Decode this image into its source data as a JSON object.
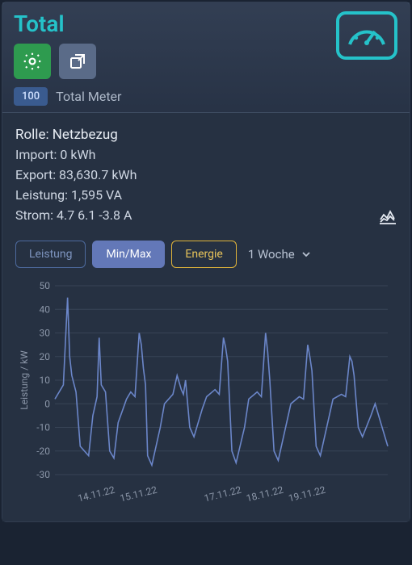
{
  "header": {
    "title": "Total",
    "badge_value": "100",
    "badge_label": "Total Meter"
  },
  "icons": {
    "gear": "gear-icon",
    "popout": "popout-icon",
    "meter": "meter-icon",
    "lines": "line-chart-icon",
    "chevron": "chevron-down-icon"
  },
  "info": {
    "role": "Rolle: Netzbezug",
    "import": "Import: 0 kWh",
    "export": "Export: 83,630.7 kWh",
    "power": "Leistung: 1,595 VA",
    "current": "Strom: 4.7 6.1 -3.8 A"
  },
  "buttons": {
    "leistung": "Leistung",
    "minmax": "Min/Max",
    "energie": "Energie"
  },
  "range": {
    "label": "1 Woche"
  },
  "chart_data": {
    "type": "line",
    "title": "",
    "xlabel": "",
    "ylabel": "Leistung / kW",
    "ylim": [
      -30,
      50
    ],
    "yticks": [
      -30,
      -20,
      -10,
      0,
      10,
      20,
      30,
      40,
      50
    ],
    "xticks": [
      "14.11.22",
      "15.11.22",
      "17.11.22",
      "18.11.22",
      "19.11.22"
    ],
    "series": [
      {
        "name": "Leistung",
        "color": "#6b86c9",
        "x": [
          13.0,
          13.2,
          13.3,
          13.35,
          13.4,
          13.5,
          13.6,
          13.8,
          13.9,
          14.0,
          14.05,
          14.1,
          14.2,
          14.3,
          14.4,
          14.5,
          14.7,
          14.8,
          14.9,
          15.0,
          15.05,
          15.1,
          15.15,
          15.2,
          15.3,
          15.5,
          15.6,
          15.8,
          15.9,
          16.0,
          16.05,
          16.1,
          16.2,
          16.3,
          16.5,
          16.6,
          16.8,
          16.9,
          17.0,
          17.05,
          17.1,
          17.2,
          17.3,
          17.5,
          17.6,
          17.8,
          17.9,
          18.0,
          18.05,
          18.1,
          18.2,
          18.3,
          18.5,
          18.6,
          18.8,
          18.9,
          19.0,
          19.05,
          19.1,
          19.2,
          19.3,
          19.5,
          19.6,
          19.8,
          19.9,
          20.0,
          20.05,
          20.1,
          20.2,
          20.3,
          20.5,
          20.6,
          20.8,
          20.9
        ],
        "values": [
          2,
          8,
          45,
          20,
          12,
          5,
          -18,
          -22,
          -5,
          3,
          28,
          8,
          5,
          -20,
          -23,
          -8,
          2,
          5,
          3,
          30,
          25,
          15,
          8,
          -22,
          -26,
          -10,
          0,
          4,
          12,
          6,
          4,
          10,
          -10,
          -14,
          -2,
          3,
          6,
          4,
          28,
          24,
          18,
          -20,
          -25,
          -10,
          2,
          5,
          3,
          30,
          22,
          10,
          -20,
          -24,
          -8,
          0,
          3,
          2,
          25,
          20,
          14,
          -18,
          -22,
          -6,
          2,
          4,
          3,
          20,
          18,
          12,
          -10,
          -14,
          -5,
          0,
          -12,
          -18
        ]
      }
    ]
  }
}
